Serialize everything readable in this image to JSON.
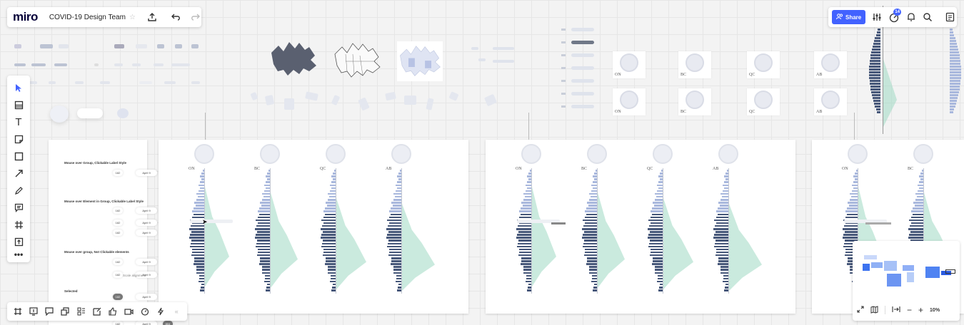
{
  "app": {
    "logo": "miro",
    "board_name": "COVID-19 Design Team"
  },
  "toolbar": {
    "share_label": "Share",
    "notification_count": "14"
  },
  "frames": {
    "badge_labels": [
      "ON",
      "BC",
      "QC",
      "AB"
    ]
  },
  "legend": {
    "section1_title": "Mouse over Group, Clickable Label Style",
    "section2_title": "Mouse over Element in Group, Clickable Label Style",
    "section3_title": "Mouse over group, Not Clickable elements",
    "section4_title": "Selected",
    "chip_left": "182",
    "chip_mid": "April 9",
    "chip_right": "804",
    "note_text": "Scale alignment"
  },
  "minimap": {
    "zoom": "10%"
  },
  "colors": {
    "accent": "#4262ff",
    "bar_dark": "#47587a",
    "bar_light": "#a9b8dd",
    "green": "#9ed8c3"
  },
  "icons": {
    "left_tools": [
      "select-cursor-icon",
      "templates-icon",
      "text-icon",
      "sticky-note-icon",
      "shape-icon",
      "pen-arrow-icon",
      "pencil-icon",
      "comment-icon",
      "frame-icon",
      "upload-icon",
      "more-icon"
    ],
    "bottom_tools": [
      "frames-list-icon",
      "screen-share-icon",
      "chat-icon",
      "cards-icon",
      "kanban-icon",
      "comments-icon",
      "reactions-icon",
      "video-icon",
      "timer-icon",
      "activity-icon"
    ]
  }
}
